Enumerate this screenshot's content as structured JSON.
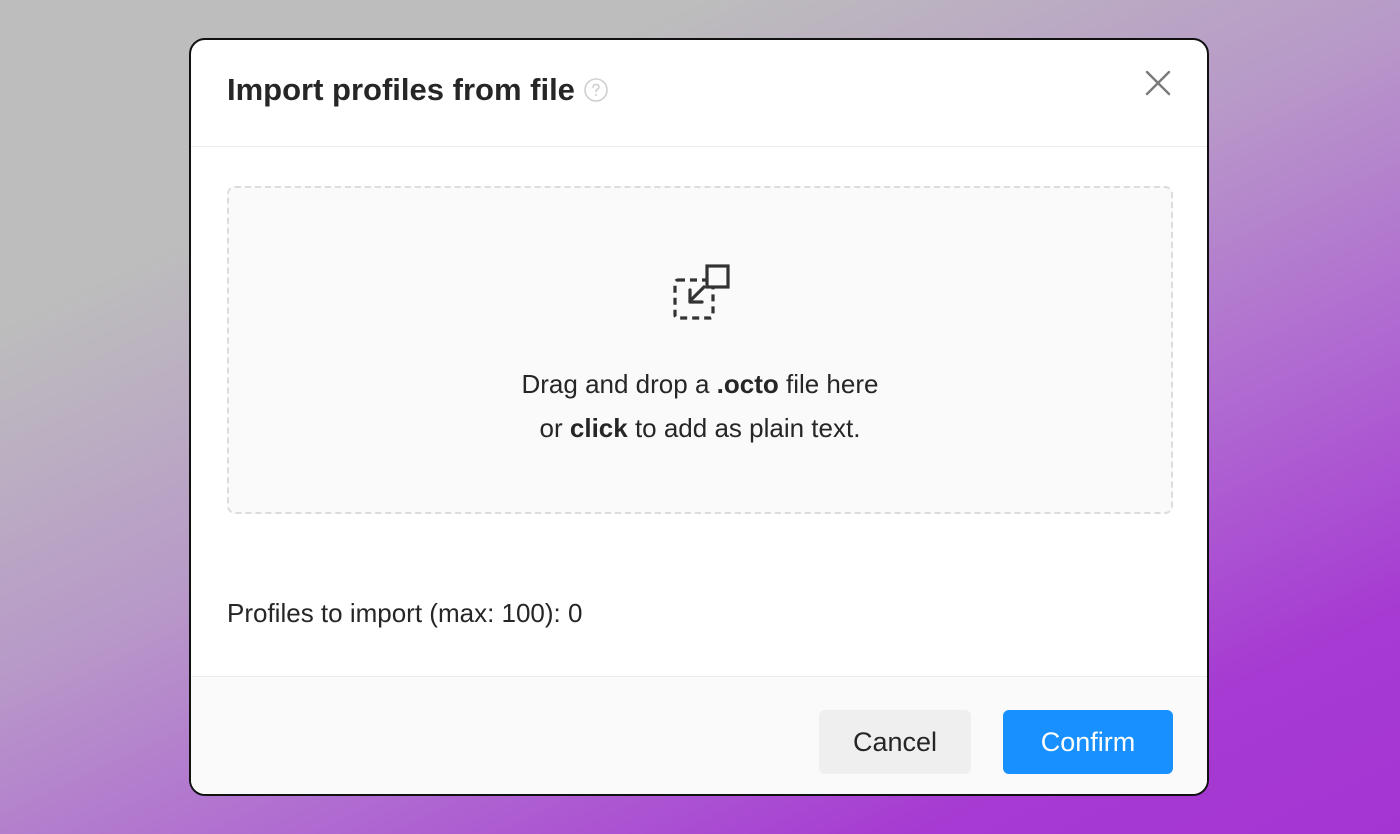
{
  "dialog": {
    "title": "Import profiles from file",
    "help_icon": "question-circle-icon",
    "close_icon": "close-icon"
  },
  "dropzone": {
    "icon": "import-file-icon",
    "line1_prefix": "Drag and drop a ",
    "line1_bold": ".octo",
    "line1_suffix": " file here",
    "line2_prefix": "or ",
    "line2_bold": "click",
    "line2_suffix": " to add as plain text."
  },
  "import_count": {
    "label": "Profiles to import (max: 100): 0"
  },
  "footer": {
    "cancel_label": "Cancel",
    "confirm_label": "Confirm"
  },
  "colors": {
    "primary": "#1890ff",
    "text": "#262626",
    "dropzone_bg": "#fafafa",
    "dropzone_border": "#dcdcdc"
  }
}
